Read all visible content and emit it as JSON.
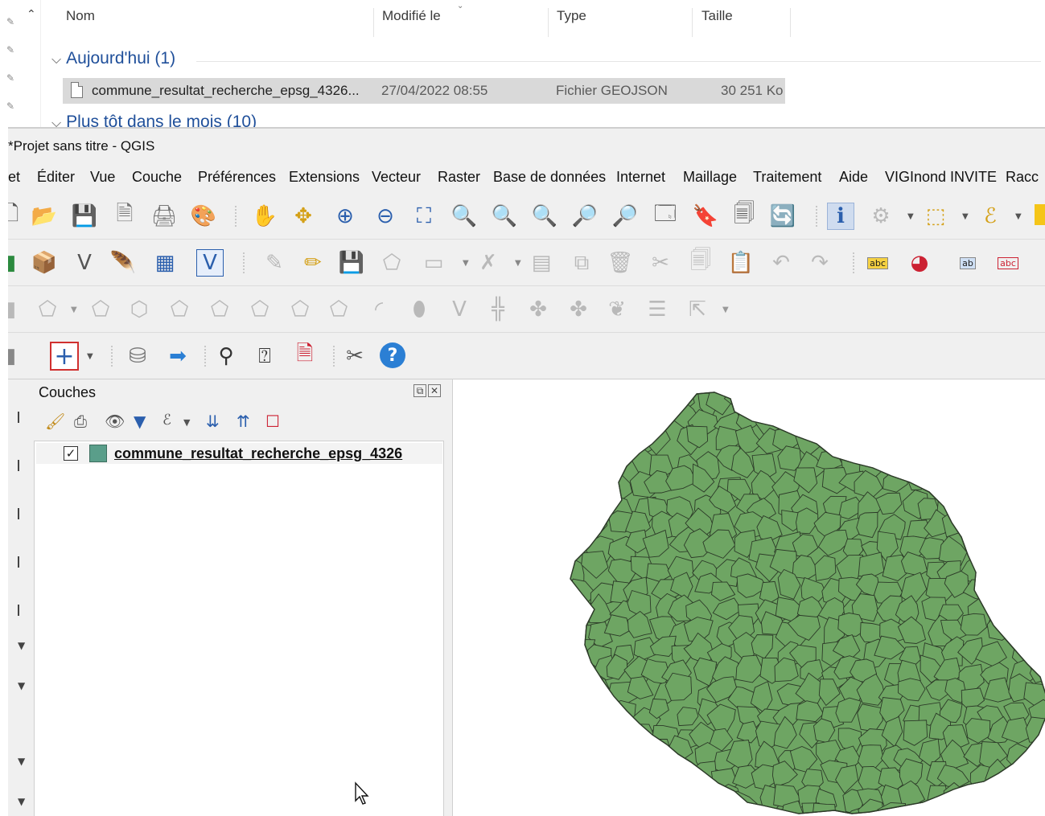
{
  "explorer": {
    "columns": {
      "name": "Nom",
      "modified": "Modifié le",
      "type": "Type",
      "size": "Taille"
    },
    "groups": [
      {
        "label": "Aujourd'hui (1)"
      },
      {
        "label": "Plus tôt dans le mois (10)"
      }
    ],
    "file": {
      "name": "commune_resultat_recherche_epsg_4326...",
      "date": "27/04/2022 08:55",
      "type": "Fichier GEOJSON",
      "size": "30 251 Ko"
    }
  },
  "qgis": {
    "title": "*Projet sans titre - QGIS",
    "menu": [
      "et",
      "Éditer",
      "Vue",
      "Couche",
      "Préférences",
      "Extensions",
      "Vecteur",
      "Raster",
      "Base de données",
      "Internet",
      "Maillage",
      "Traitement",
      "Aide",
      "VIGInond INVITE",
      "Racc"
    ],
    "layers_panel": {
      "title": "Couches",
      "layer": {
        "name": "commune_resultat_recherche_epsg_4326",
        "checked": "✓",
        "color": "#5a9e8a"
      }
    },
    "map": {
      "fill_color": "#6ea563",
      "stroke_color": "#2c3a28"
    }
  }
}
